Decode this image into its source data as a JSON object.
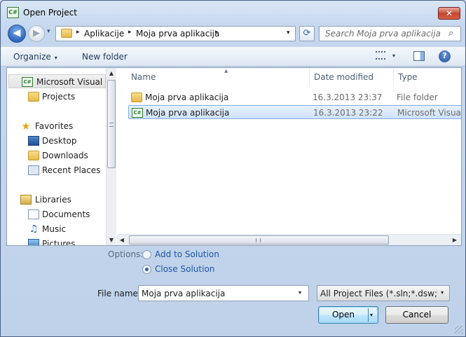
{
  "window": {
    "title": "Open Project",
    "close_glyph": "✕",
    "app_icon_text": "C#"
  },
  "nav": {
    "back_glyph": "◀",
    "forward_glyph": "▶",
    "dropdown_glyph": "▾"
  },
  "address": {
    "crumbs": [
      "Aplikacije",
      "Moja prva aplikacija"
    ],
    "separator": "▸",
    "dropdown_glyph": "▾",
    "refresh_glyph": "⟳"
  },
  "search": {
    "placeholder": "Search Moja prva aplikacija",
    "icon_glyph": "⌕"
  },
  "toolbar": {
    "organize_label": "Organize",
    "new_folder_label": "New folder",
    "caret": "▾",
    "help_glyph": "?"
  },
  "sidebar": {
    "items": [
      {
        "label": "Microsoft Visual C#",
        "icon": "csharp-project-icon"
      },
      {
        "label": "Projects",
        "icon": "folder-icon"
      },
      {
        "label": "Favorites",
        "icon": "star-icon"
      },
      {
        "label": "Desktop",
        "icon": "desktop-icon"
      },
      {
        "label": "Downloads",
        "icon": "downloads-icon"
      },
      {
        "label": "Recent Places",
        "icon": "recent-places-icon"
      },
      {
        "label": "Libraries",
        "icon": "libraries-icon"
      },
      {
        "label": "Documents",
        "icon": "documents-icon"
      },
      {
        "label": "Music",
        "icon": "music-icon"
      },
      {
        "label": "Pictures",
        "icon": "pictures-icon"
      }
    ],
    "star_glyph": "★",
    "music_glyph": "♫"
  },
  "scroll": {
    "up": "▲",
    "down": "▼",
    "left": "◀",
    "right": "▶",
    "grip": "≡"
  },
  "files": {
    "columns": [
      "Name",
      "Date modified",
      "Type"
    ],
    "sort_indicator": "▲",
    "rows": [
      {
        "name": "Moja prva aplikacija",
        "date": "16.3.2013 23:37",
        "type": "File folder",
        "icon": "folder-icon"
      },
      {
        "name": "Moja prva aplikacija",
        "date": "16.3.2013 23:22",
        "type": "Microsoft Visual S",
        "icon": "csharp-solution-icon"
      }
    ]
  },
  "options": {
    "label": "Options:",
    "add_to_solution": "Add to Solution",
    "close_solution": "Close Solution",
    "selected": "close_solution"
  },
  "filename": {
    "label": "File name:",
    "value": "Moja prva aplikacija",
    "dropdown_glyph": "▾"
  },
  "filter": {
    "value": "All Project Files (*.sln;*.dsw;*.vcw",
    "dropdown_glyph": "▾"
  },
  "buttons": {
    "open": "Open",
    "cancel": "Cancel",
    "open_dd": "▾"
  }
}
